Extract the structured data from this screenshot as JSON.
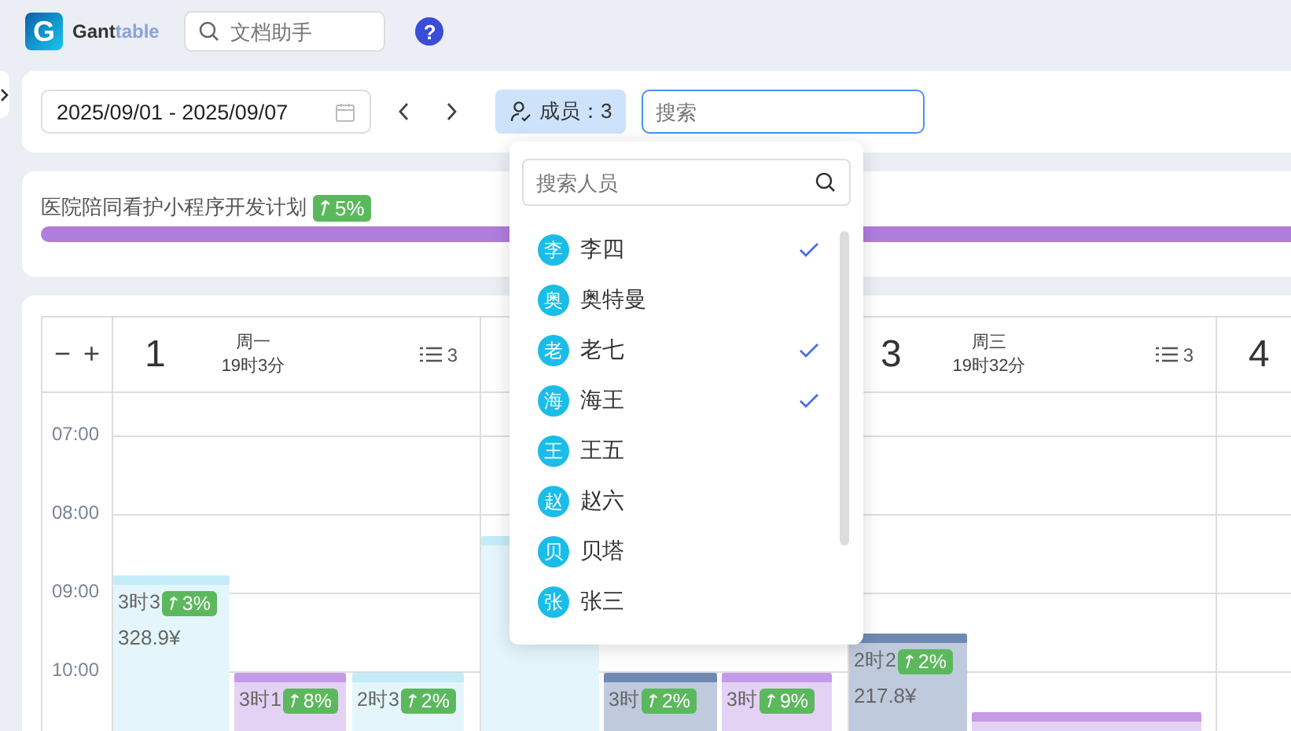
{
  "app": {
    "logo_letter": "G",
    "name_main": "Gant",
    "name_accent": "table",
    "search_placeholder": "文档助手",
    "help": "?"
  },
  "toolbar": {
    "date_range": "2025/09/01 - 2025/09/07",
    "members_button": "成员：3",
    "search_placeholder": "搜索"
  },
  "project": {
    "title": "医院陪同看护小程序开发计划",
    "badge": "5%",
    "level": 1
  },
  "members_dropdown": {
    "search_placeholder": "搜索人员",
    "members": [
      {
        "avatar": "李",
        "name": "李四",
        "checked": true
      },
      {
        "avatar": "奥",
        "name": "奥特曼",
        "checked": false
      },
      {
        "avatar": "老",
        "name": "老七",
        "checked": true
      },
      {
        "avatar": "海",
        "name": "海王",
        "checked": true
      },
      {
        "avatar": "王",
        "name": "王五",
        "checked": false
      },
      {
        "avatar": "赵",
        "name": "赵六",
        "checked": false
      },
      {
        "avatar": "贝",
        "name": "贝塔",
        "checked": false
      },
      {
        "avatar": "张",
        "name": "张三",
        "checked": false
      }
    ]
  },
  "calendar": {
    "zoom_out": "−",
    "zoom_in": "+",
    "times": [
      "07:00",
      "08:00",
      "09:00",
      "10:00"
    ],
    "days": [
      {
        "date": "1",
        "weekday": "周一",
        "total": "19时3分",
        "count": "3",
        "events": [
          {
            "duration": "3时3",
            "badge": "3%",
            "price": "328.9¥",
            "color": "#c4ecf8"
          },
          {
            "duration": "3时1",
            "badge": "8%",
            "color": "#c49be6"
          },
          {
            "duration": "2时3",
            "badge": "2%",
            "color": "#c4ecf8"
          }
        ]
      },
      {
        "events": [
          {
            "color": "#c4ecf8"
          },
          {
            "duration": "3时",
            "badge": "2%",
            "color": "#7089b3"
          },
          {
            "duration": "3时",
            "badge": "9%",
            "color": "#c49be6"
          }
        ]
      },
      {
        "date": "3",
        "weekday": "周三",
        "total": "19时32分",
        "count": "3",
        "events": [
          {
            "duration": "2时2",
            "badge": "2%",
            "price": "217.8¥",
            "color": "#7089b3"
          },
          {
            "color": "#c49be6"
          }
        ]
      },
      {
        "date": "4"
      }
    ]
  }
}
